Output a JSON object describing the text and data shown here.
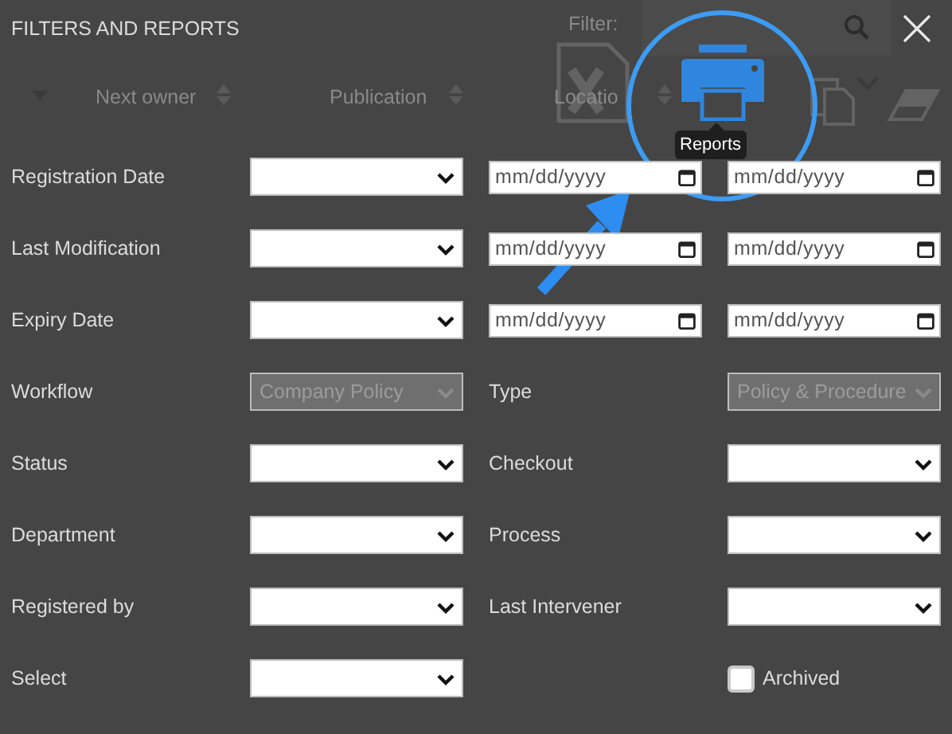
{
  "title": "FILTERS AND REPORTS",
  "background": {
    "filter_label": "Filter:",
    "columns": [
      "Next owner",
      "Publication",
      "Locatio"
    ]
  },
  "tooltip": "Reports",
  "rows": [
    {
      "label": "Registration Date",
      "select": {
        "disabled": false
      },
      "cells": [
        {
          "kind": "date",
          "placeholder": "mm/dd/yyyy"
        },
        {
          "kind": "date",
          "placeholder": "mm/dd/yyyy"
        }
      ]
    },
    {
      "label": "Last Modification",
      "select": {
        "disabled": false
      },
      "cells": [
        {
          "kind": "date",
          "placeholder": "mm/dd/yyyy"
        },
        {
          "kind": "date",
          "placeholder": "mm/dd/yyyy"
        }
      ]
    },
    {
      "label": "Expiry Date",
      "select": {
        "disabled": false
      },
      "cells": [
        {
          "kind": "date",
          "placeholder": "mm/dd/yyyy"
        },
        {
          "kind": "date",
          "placeholder": "mm/dd/yyyy"
        }
      ]
    },
    {
      "label": "Workflow",
      "select": {
        "value": "Company Policy",
        "disabled": true
      },
      "cells": [
        {
          "kind": "label",
          "text": "Type"
        },
        {
          "kind": "select",
          "value": "Policy & Procedure",
          "disabled": true
        }
      ]
    },
    {
      "label": "Status",
      "select": {
        "disabled": false
      },
      "cells": [
        {
          "kind": "label",
          "text": "Checkout"
        },
        {
          "kind": "select",
          "disabled": false
        }
      ]
    },
    {
      "label": "Department",
      "select": {
        "disabled": false
      },
      "cells": [
        {
          "kind": "label",
          "text": "Process"
        },
        {
          "kind": "select",
          "disabled": false
        }
      ]
    },
    {
      "label": "Registered by",
      "select": {
        "disabled": false
      },
      "cells": [
        {
          "kind": "label",
          "text": "Last Intervener"
        },
        {
          "kind": "select",
          "disabled": false
        }
      ]
    },
    {
      "label": "Select",
      "select": {
        "disabled": false
      },
      "cells": [
        {
          "kind": "checkbox",
          "label": "Archived",
          "checked": false
        }
      ]
    }
  ]
}
